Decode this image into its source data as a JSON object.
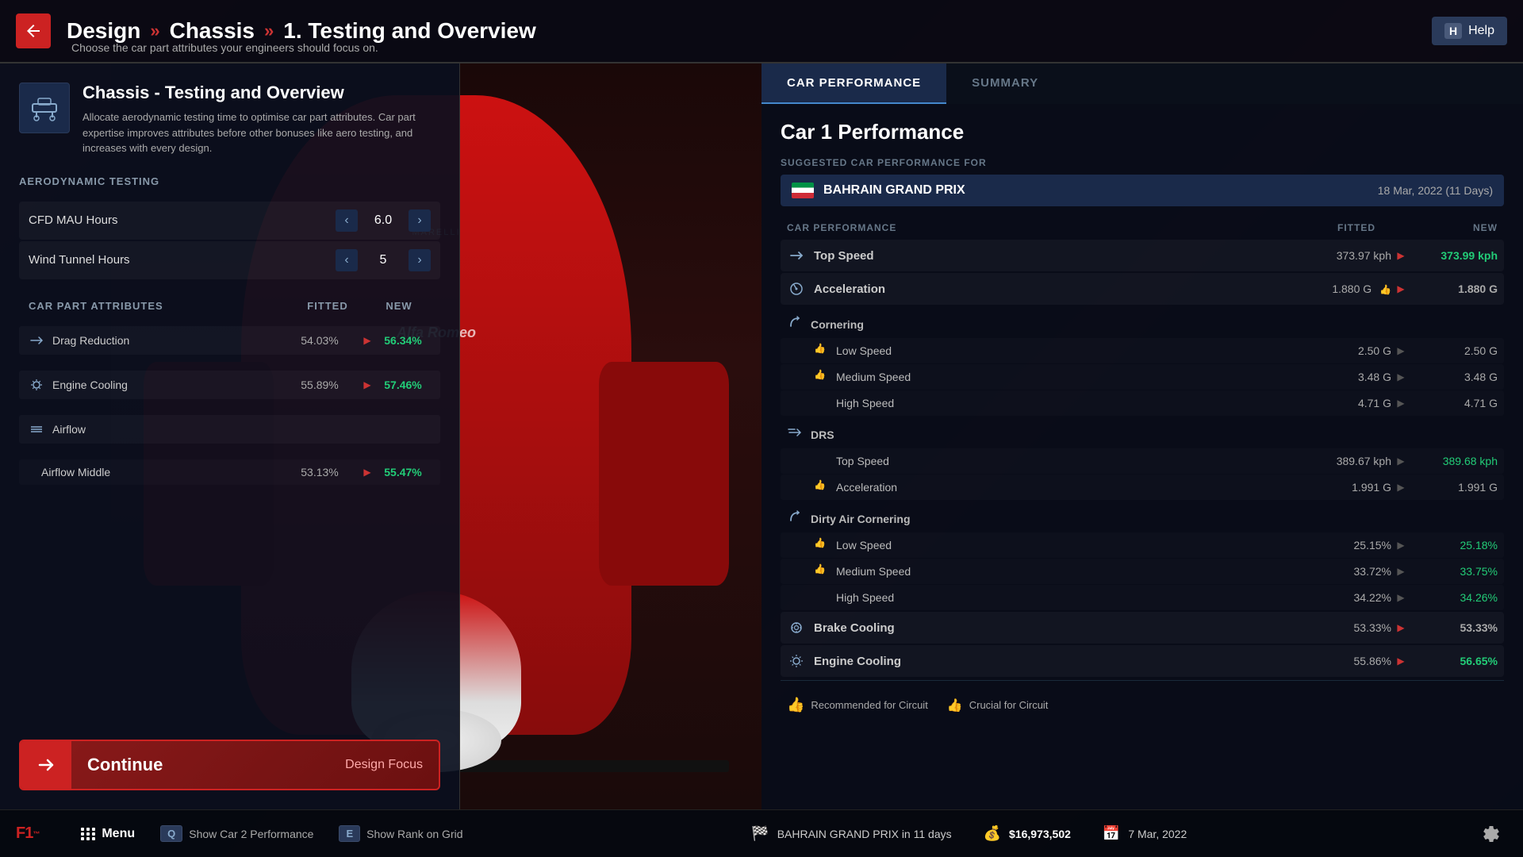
{
  "header": {
    "back_label": "←",
    "breadcrumb": [
      {
        "label": "Design",
        "separator": "»"
      },
      {
        "label": "Chassis",
        "separator": "»"
      },
      {
        "label": "1. Testing and Overview"
      }
    ],
    "subtitle": "Choose the car part attributes your engineers should focus on.",
    "help_key": "H",
    "help_label": "Help"
  },
  "left_panel": {
    "icon_alt": "chassis-icon",
    "title": "Chassis - Testing and Overview",
    "description": "Allocate aerodynamic testing time to optimise car part attributes. Car part expertise improves attributes before other bonuses like aero testing, and increases with every design.",
    "aero_section_label": "AERODYNAMIC TESTING",
    "aero_rows": [
      {
        "label": "CFD MAU Hours",
        "value": "6.0"
      },
      {
        "label": "Wind Tunnel Hours",
        "value": "5"
      }
    ],
    "attributes_section_label": "CAR PART ATTRIBUTES",
    "fitted_col": "FITTED",
    "new_col": "NEW",
    "attributes": [
      {
        "name": "Drag Reduction",
        "icon": "drag-icon",
        "fitted": "54.03%",
        "arrow": "▶",
        "new_val": "56.34%",
        "improved": true,
        "sub": false
      },
      {
        "name": "Engine Cooling",
        "icon": "engine-icon",
        "fitted": "55.89%",
        "arrow": "▶",
        "new_val": "57.46%",
        "improved": true,
        "sub": false
      },
      {
        "name": "Airflow",
        "icon": "airflow-icon",
        "fitted": "",
        "arrow": "",
        "new_val": "",
        "improved": false,
        "sub": false
      },
      {
        "name": "Airflow Middle",
        "icon": "",
        "fitted": "53.13%",
        "arrow": "▶",
        "new_val": "55.47%",
        "improved": true,
        "sub": true
      }
    ],
    "continue_label": "Continue",
    "design_focus_label": "Design Focus"
  },
  "right_panel": {
    "tabs": [
      {
        "label": "CAR PERFORMANCE",
        "active": true
      },
      {
        "label": "SUMMARY",
        "active": false
      }
    ],
    "car1_title": "Car 1 Performance",
    "suggested_label": "SUGGESTED CAR PERFORMANCE FOR",
    "grand_prix": {
      "name": "BAHRAIN GRAND PRIX",
      "date": "18 Mar, 2022 (11 Days)"
    },
    "perf_header": {
      "label": "CAR PERFORMANCE",
      "fitted": "FITTED",
      "new": "NEW"
    },
    "top_speed": {
      "label": "Top Speed",
      "fitted": "373.97 kph",
      "arrow": "▶",
      "new_val": "373.99 kph",
      "improved": true
    },
    "acceleration": {
      "label": "Acceleration",
      "fitted": "1.880 G",
      "arrow": "▶",
      "new_val": "1.880 G",
      "improved": false
    },
    "cornering": {
      "group_label": "Cornering",
      "sub_rows": [
        {
          "label": "Low Speed",
          "has_thumb": true,
          "fitted": "2.50 G",
          "arrow": "▶",
          "new_val": "2.50 G",
          "improved": false
        },
        {
          "label": "Medium Speed",
          "has_thumb": true,
          "fitted": "3.48 G",
          "arrow": "▶",
          "new_val": "3.48 G",
          "improved": false
        },
        {
          "label": "High Speed",
          "has_thumb": false,
          "fitted": "4.71 G",
          "arrow": "▶",
          "new_val": "4.71 G",
          "improved": false
        }
      ]
    },
    "drs": {
      "group_label": "DRS",
      "sub_rows": [
        {
          "label": "Top Speed",
          "has_thumb": false,
          "fitted": "389.67 kph",
          "arrow": "▶",
          "new_val": "389.68 kph",
          "improved": true
        },
        {
          "label": "Acceleration",
          "has_thumb": true,
          "fitted": "1.991 G",
          "arrow": "▶",
          "new_val": "1.991 G",
          "improved": false
        }
      ]
    },
    "dirty_air": {
      "group_label": "Dirty Air Cornering",
      "sub_rows": [
        {
          "label": "Low Speed",
          "has_thumb": true,
          "fitted": "25.15%",
          "arrow": "▶",
          "new_val": "25.18%",
          "improved": true
        },
        {
          "label": "Medium Speed",
          "has_thumb": true,
          "fitted": "33.72%",
          "arrow": "▶",
          "new_val": "33.75%",
          "improved": true
        },
        {
          "label": "High Speed",
          "has_thumb": false,
          "fitted": "34.22%",
          "arrow": "▶",
          "new_val": "34.26%",
          "improved": true
        }
      ]
    },
    "brake_cooling": {
      "label": "Brake Cooling",
      "fitted": "53.33%",
      "arrow": "▶",
      "new_val": "53.33%",
      "improved": false
    },
    "engine_cooling": {
      "label": "Engine Cooling",
      "fitted": "55.86%",
      "arrow": "▶",
      "new_val": "56.65%",
      "improved": true
    },
    "legend": [
      {
        "icon": "thumb-up-green",
        "label": "Recommended for Circuit"
      },
      {
        "icon": "thumb-up-teal",
        "label": "Crucial for Circuit"
      }
    ]
  },
  "bottom_bar": {
    "logo": "F1",
    "menu_label": "Menu",
    "shortcuts": [
      {
        "key": "Q",
        "label": "Show Car 2 Performance"
      },
      {
        "key": "E",
        "label": "Show Rank on Grid"
      }
    ],
    "grand_prix_info": "BAHRAIN GRAND PRIX in 11 days",
    "money": "$16,973,502",
    "date": "7 Mar, 2022"
  }
}
